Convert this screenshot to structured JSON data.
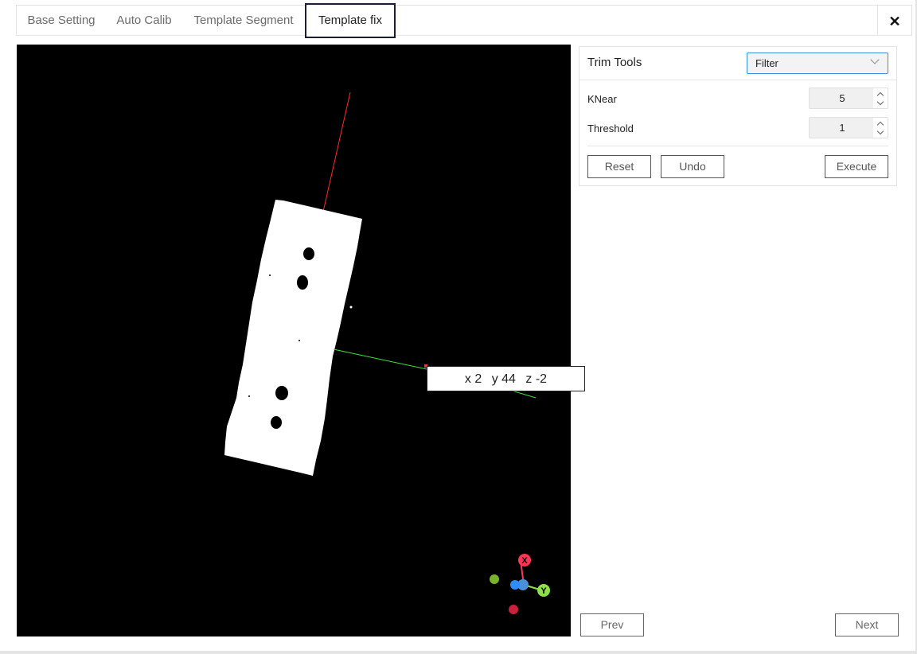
{
  "tabs": [
    {
      "label": "Base Setting",
      "active": false
    },
    {
      "label": "Auto Calib",
      "active": false
    },
    {
      "label": "Template Segment",
      "active": false
    },
    {
      "label": "Template fix",
      "active": true
    }
  ],
  "close_icon": "close-icon",
  "viewport": {
    "coords": {
      "x": "x 2",
      "y": "y 44",
      "z": "z -2"
    },
    "gizmo": {
      "x_label": "X",
      "y_label": "Y"
    },
    "axis_colors": {
      "x": "#ff3030",
      "y": "#44ee44",
      "z": "#3050ff"
    }
  },
  "trim_tools": {
    "label": "Trim Tools",
    "mode_value": "Filter",
    "knear_label": "KNear",
    "knear_value": "5",
    "threshold_label": "Threshold",
    "threshold_value": "1",
    "reset_label": "Reset",
    "undo_label": "Undo",
    "execute_label": "Execute"
  },
  "footer": {
    "prev_label": "Prev",
    "next_label": "Next"
  }
}
